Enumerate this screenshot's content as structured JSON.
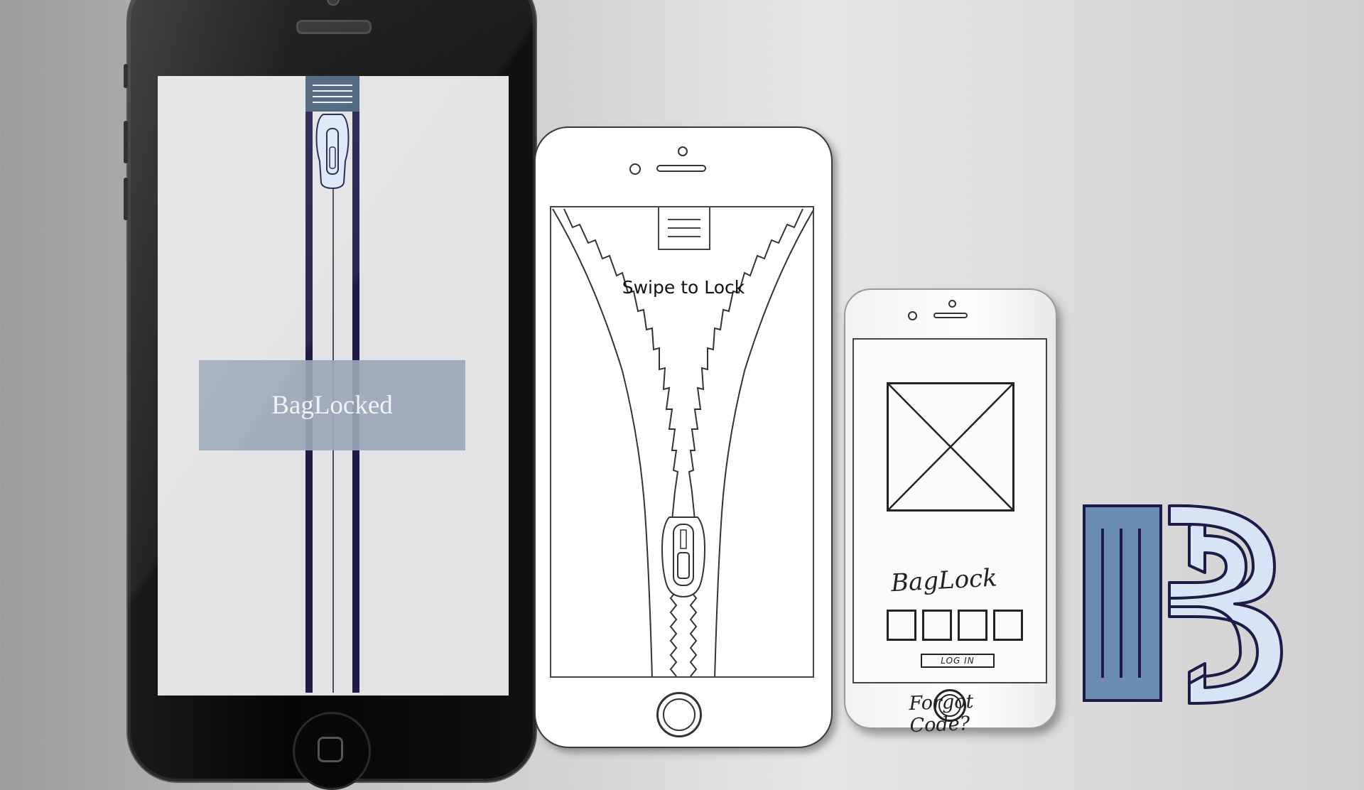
{
  "phone_dark": {
    "app_title": "BagLocked",
    "menu_icon": "hamburger-menu-icon",
    "slider_icon": "zipper-pull-icon",
    "colors": {
      "strap": "#1e1c47",
      "menu_bg": "#455c75",
      "banner_bg": "#9ba8b8",
      "screen_bg": "#e3e3e5"
    }
  },
  "phone_wireframe": {
    "instruction": "Swipe to Lock",
    "menu_icon": "hamburger-menu-icon",
    "slider_icon": "zipper-pull-icon"
  },
  "phone_sketch": {
    "app_name": "BagLock",
    "image_placeholder_icon": "image-placeholder-icon",
    "code_boxes": [
      "",
      "",
      "",
      ""
    ],
    "login_label": "LOG IN",
    "forgot_label": "Forgot Code?"
  },
  "logo": {
    "icon": "baglock-logo-icon",
    "colors": {
      "fill": "#6b8db5",
      "outline": "#1e1c47",
      "light": "#d6e4f6"
    }
  }
}
